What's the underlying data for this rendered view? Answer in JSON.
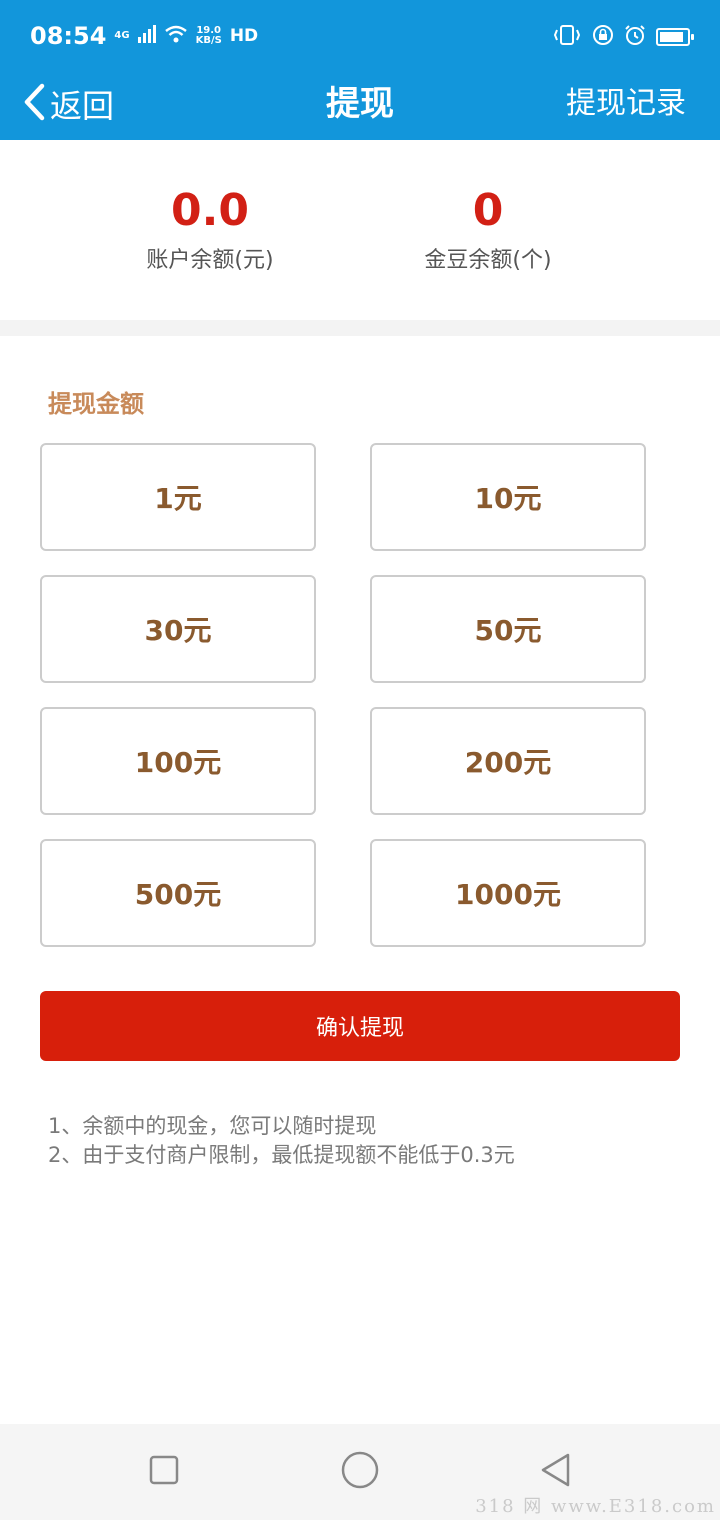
{
  "status_bar": {
    "time": "08:54",
    "network_type": "4G",
    "speed_value": "19.0",
    "speed_unit": "KB/S",
    "hd": "HD",
    "icons": [
      "signal-icon",
      "wifi-icon",
      "vibrate-icon",
      "lock-rotation-icon",
      "alarm-icon",
      "battery-icon"
    ],
    "battery_level": 0.9
  },
  "nav": {
    "back_label": "返回",
    "title": "提现",
    "record_label": "提现记录",
    "color": "#1296db"
  },
  "balance": {
    "account_value": "0.0",
    "account_label": "账户余额(元)",
    "beans_value": "0",
    "beans_label": "金豆余额(个)",
    "value_color": "#d22015"
  },
  "amount_section": {
    "title": "提现金额",
    "options": [
      "1元",
      "10元",
      "30元",
      "50元",
      "100元",
      "200元",
      "500元",
      "1000元"
    ]
  },
  "confirm_label": "确认提现",
  "confirm_color": "#d71f0b",
  "notes": [
    "1、余额中的现金，您可以随时提现",
    "2、由于支付商户限制，最低提现额不能低于0.3元"
  ],
  "watermark": "318 网 www.E318.com"
}
